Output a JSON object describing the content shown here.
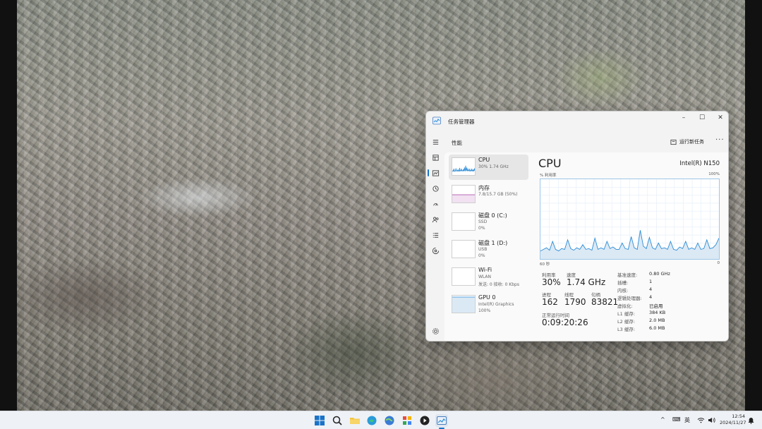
{
  "window": {
    "title": "任务管理器",
    "header_title": "性能",
    "run_task_label": "运行新任务",
    "more_label": "···",
    "minimize": "–",
    "maximize": "☐",
    "close": "✕"
  },
  "sidebar_icons": [
    "menu-icon",
    "processes-icon",
    "performance-icon",
    "app-history-icon",
    "startup-icon",
    "users-icon",
    "details-icon",
    "services-icon",
    "settings-icon"
  ],
  "resources": [
    {
      "name": "CPU",
      "sub1": "30% 1.74 GHz",
      "sub2": ""
    },
    {
      "name": "内存",
      "sub1": "7.8/15.7 GB (50%)",
      "sub2": ""
    },
    {
      "name": "磁盘 0 (C:)",
      "sub1": "SSD",
      "sub2": "0%"
    },
    {
      "name": "磁盘 1 (D:)",
      "sub1": "USB",
      "sub2": "0%"
    },
    {
      "name": "Wi-Fi",
      "sub1": "WLAN",
      "sub2": "发送: 0 接收: 0 Kbps"
    },
    {
      "name": "GPU 0",
      "sub1": "Intel(R) Graphics",
      "sub2": "100%"
    }
  ],
  "detail": {
    "title": "CPU",
    "model": "Intel(R) N150",
    "util_label": "% 利用率",
    "max_label": "100%",
    "time_label": "60 秒",
    "min_label": "0",
    "stats": {
      "util_label": "利用率",
      "util_value": "30%",
      "speed_label": "速度",
      "speed_value": "1.74 GHz",
      "proc_label": "进程",
      "proc_value": "162",
      "thread_label": "线程",
      "thread_value": "1790",
      "handle_label": "句柄",
      "handle_value": "83821",
      "uptime_label": "正常运行时间",
      "uptime_value": "0:09:20:26"
    },
    "specs": [
      {
        "k": "基准速度:",
        "v": "0.80 GHz"
      },
      {
        "k": "插槽:",
        "v": "1"
      },
      {
        "k": "内核:",
        "v": "4"
      },
      {
        "k": "逻辑处理器:",
        "v": "4"
      },
      {
        "k": "虚拟化:",
        "v": "已启用"
      },
      {
        "k": "L1 缓存:",
        "v": "384 KB"
      },
      {
        "k": "L2 缓存:",
        "v": "2.0 MB"
      },
      {
        "k": "L3 缓存:",
        "v": "6.0 MB"
      }
    ]
  },
  "cpu_history": [
    0.1,
    0.12,
    0.14,
    0.11,
    0.22,
    0.12,
    0.1,
    0.13,
    0.12,
    0.24,
    0.13,
    0.11,
    0.14,
    0.12,
    0.18,
    0.12,
    0.13,
    0.11,
    0.26,
    0.12,
    0.14,
    0.12,
    0.22,
    0.13,
    0.15,
    0.12,
    0.12,
    0.2,
    0.13,
    0.12,
    0.28,
    0.14,
    0.12,
    0.36,
    0.16,
    0.13,
    0.27,
    0.14,
    0.12,
    0.2,
    0.13,
    0.14,
    0.12,
    0.22,
    0.12,
    0.11,
    0.15,
    0.13,
    0.22,
    0.12,
    0.14,
    0.12,
    0.2,
    0.12,
    0.13,
    0.24,
    0.13,
    0.14,
    0.18,
    0.26
  ],
  "colors": {
    "cpu_line": "#2b8cd6",
    "cpu_fill": "#dbe9f5",
    "mem_line": "#a33ea3",
    "accent": "#1a73c8"
  },
  "tray": {
    "chevron": "^",
    "keyboard": "⌨",
    "ime": "英",
    "wifi": "wifi-icon",
    "volume": "volume-icon",
    "time": "12:54",
    "date": "2024/11/27"
  }
}
